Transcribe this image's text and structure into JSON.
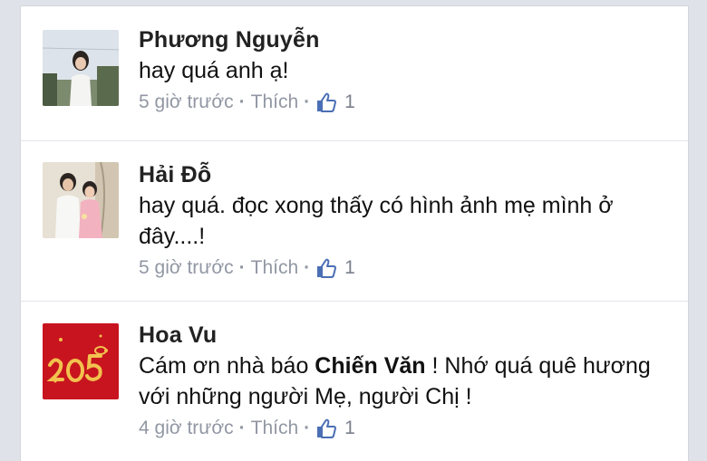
{
  "comments": [
    {
      "author": "Phương Nguyễn",
      "text": "hay quá anh ạ!",
      "time": "5 giờ trước",
      "like_label": "Thích",
      "separator": "·",
      "like_count": "1"
    },
    {
      "author": "Hải Đỗ",
      "text": "hay quá. đọc xong thấy có hình ảnh mẹ mình ở đây....!",
      "time": "5 giờ trước",
      "like_label": "Thích",
      "separator": "·",
      "like_count": "1"
    },
    {
      "author": "Hoa Vu",
      "text_before": "Cám ơn nhà báo ",
      "text_mention": "Chiến Văn",
      "text_after": " ! Nhớ quá quê hương với những người Mẹ, người Chị !",
      "time": "4 giờ trước",
      "like_label": "Thích",
      "separator": "·",
      "like_count": "1"
    }
  ],
  "colors": {
    "page_bg": "#dfe2e8",
    "meta_text": "#9197a3",
    "like_icon": "#4a6fb5",
    "avatar3_bg": "#c8141e"
  }
}
